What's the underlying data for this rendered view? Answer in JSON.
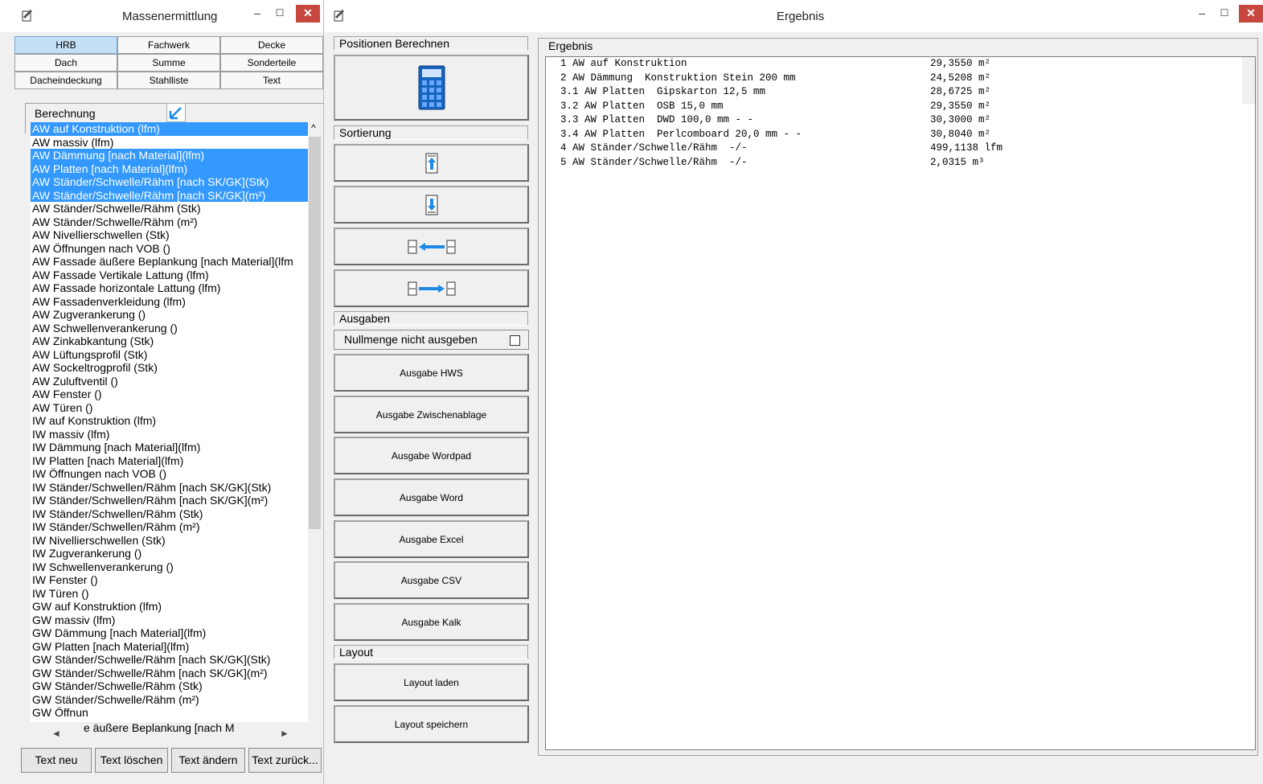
{
  "win1": {
    "title": "Massenermittlung",
    "minimize": "–",
    "maximize": "☐",
    "close": "✕",
    "tabs": [
      [
        "HRB",
        "Fachwerk",
        "Decke"
      ],
      [
        "Dach",
        "Summe",
        "Sonderteile"
      ],
      [
        "Dacheindeckung",
        "Stahlliste",
        "Text"
      ]
    ],
    "group_label": "Berechnung",
    "list_items": [
      {
        "text": "AW auf Konstruktion (lfm)",
        "selected": true
      },
      {
        "text": "AW massiv (lfm)",
        "selected": false
      },
      {
        "text": "AW Dämmung [nach Material](lfm)",
        "selected": true
      },
      {
        "text": "AW Platten [nach Material](lfm)",
        "selected": true
      },
      {
        "text": "AW Ständer/Schwelle/Rähm [nach SK/GK](Stk)",
        "selected": true
      },
      {
        "text": "AW Ständer/Schwelle/Rähm [nach SK/GK](m²)",
        "selected": true
      },
      {
        "text": "AW Ständer/Schwelle/Rähm (Stk)",
        "selected": false
      },
      {
        "text": "AW Ständer/Schwelle/Rähm (m²)",
        "selected": false
      },
      {
        "text": "AW Nivellierschwellen (Stk)",
        "selected": false
      },
      {
        "text": "AW Öffnungen nach VOB ()",
        "selected": false
      },
      {
        "text": "AW Fassade äußere Beplankung [nach Material](lfm",
        "selected": false
      },
      {
        "text": "AW Fassade Vertikale Lattung (lfm)",
        "selected": false
      },
      {
        "text": "AW Fassade horizontale Lattung (lfm)",
        "selected": false
      },
      {
        "text": "AW Fassadenverkleidung (lfm)",
        "selected": false
      },
      {
        "text": "AW Zugverankerung ()",
        "selected": false
      },
      {
        "text": "AW Schwellenverankerung ()",
        "selected": false
      },
      {
        "text": "AW Zinkabkantung (Stk)",
        "selected": false
      },
      {
        "text": "AW Lüftungsprofil (Stk)",
        "selected": false
      },
      {
        "text": "AW Sockeltrogprofil (Stk)",
        "selected": false
      },
      {
        "text": "AW Zuluftventil ()",
        "selected": false
      },
      {
        "text": "AW Fenster ()",
        "selected": false
      },
      {
        "text": "AW Türen ()",
        "selected": false
      },
      {
        "text": "IW auf Konstruktion (lfm)",
        "selected": false
      },
      {
        "text": "IW massiv (lfm)",
        "selected": false
      },
      {
        "text": "IW Dämmung [nach Material](lfm)",
        "selected": false
      },
      {
        "text": "IW Platten [nach Material](lfm)",
        "selected": false
      },
      {
        "text": "IW Öffnungen nach VOB ()",
        "selected": false
      },
      {
        "text": "IW Ständer/Schwellen/Rähm [nach SK/GK](Stk)",
        "selected": false
      },
      {
        "text": "IW Ständer/Schwellen/Rähm [nach SK/GK](m²)",
        "selected": false
      },
      {
        "text": "IW Ständer/Schwellen/Rähm (Stk)",
        "selected": false
      },
      {
        "text": "IW Ständer/Schwellen/Rähm (m²)",
        "selected": false
      },
      {
        "text": "IW Nivellierschwellen (Stk)",
        "selected": false
      },
      {
        "text": "IW Zugverankerung ()",
        "selected": false
      },
      {
        "text": "IW Schwellenverankerung ()",
        "selected": false
      },
      {
        "text": "IW Fenster ()",
        "selected": false
      },
      {
        "text": "IW Türen ()",
        "selected": false
      },
      {
        "text": "GW auf Konstruktion (lfm)",
        "selected": false
      },
      {
        "text": "GW massiv (lfm)",
        "selected": false
      },
      {
        "text": "GW Dämmung [nach Material](lfm)",
        "selected": false
      },
      {
        "text": "GW Platten [nach Material](lfm)",
        "selected": false
      },
      {
        "text": "GW Ständer/Schwelle/Rähm [nach SK/GK](Stk)",
        "selected": false
      },
      {
        "text": "GW Ständer/Schwelle/Rähm [nach SK/GK](m²)",
        "selected": false
      },
      {
        "text": "GW Ständer/Schwelle/Rähm (Stk)",
        "selected": false
      },
      {
        "text": "GW Ständer/Schwelle/Rähm (m²)",
        "selected": false
      },
      {
        "text": "GW Öffnun",
        "selected": false
      }
    ],
    "partial_last_item": "e äußere Beplankung [nach M",
    "scroll_left": "◄",
    "scroll_right": "►",
    "scroll_up": "^",
    "buttons": [
      "Text neu",
      "Text löschen",
      "Text ändern",
      "Text zurück..."
    ]
  },
  "win2": {
    "title": "Ergebnis",
    "minimize": "–",
    "maximize": "☐",
    "close": "✕",
    "sections": {
      "positionen": "Positionen Berechnen",
      "sortierung": "Sortierung",
      "ausgaben": "Ausgaben",
      "layout": "Layout"
    },
    "nullmenge_label": "Nullmenge nicht ausgeben",
    "nullmenge_checked": false,
    "output_buttons": [
      "Ausgabe HWS",
      "Ausgabe Zwischenablage",
      "Ausgabe Wordpad",
      "Ausgabe Word",
      "Ausgabe Excel",
      "Ausgabe CSV",
      "Ausgabe Kalk"
    ],
    "layout_buttons": [
      "Layout laden",
      "Layout speichern"
    ],
    "result_header": "Ergebnis",
    "result_rows": [
      {
        "text": "1 AW auf Konstruktion",
        "value": "29,3550 m²"
      },
      {
        "text": "2 AW Dämmung  Konstruktion Stein 200 mm",
        "value": "24,5208 m²"
      },
      {
        "text": "3.1 AW Platten  Gipskarton 12,5 mm",
        "value": "28,6725 m²"
      },
      {
        "text": "3.2 AW Platten  OSB 15,0 mm",
        "value": "29,3550 m²"
      },
      {
        "text": "3.3 AW Platten  DWD 100,0 mm - -",
        "value": "30,3000 m²"
      },
      {
        "text": "3.4 AW Platten  Perlcomboard 20,0 mm - -",
        "value": "30,8040 m²"
      },
      {
        "text": "4 AW Ständer/Schwelle/Rähm  -/-",
        "value": "499,1138 lfm"
      },
      {
        "text": "5 AW Ständer/Schwelle/Rähm  -/-",
        "value": "2,0315 m³"
      }
    ]
  },
  "colors": {
    "selection": "#3399ff",
    "active_tab": "#c5e0f5",
    "close_button": "#c7463d",
    "window_bg": "#f0f0f0",
    "calc_icon": "#1565c0",
    "arrow_blue": "#1e88e5"
  },
  "icons": {
    "app": "app-icon",
    "calculator": "calculator-icon",
    "sort_up": "arrow-up-icon",
    "sort_down": "arrow-down-icon",
    "sort_left": "arrow-left-icon",
    "sort_right": "arrow-right-icon",
    "resize": "resize-corner-icon"
  }
}
